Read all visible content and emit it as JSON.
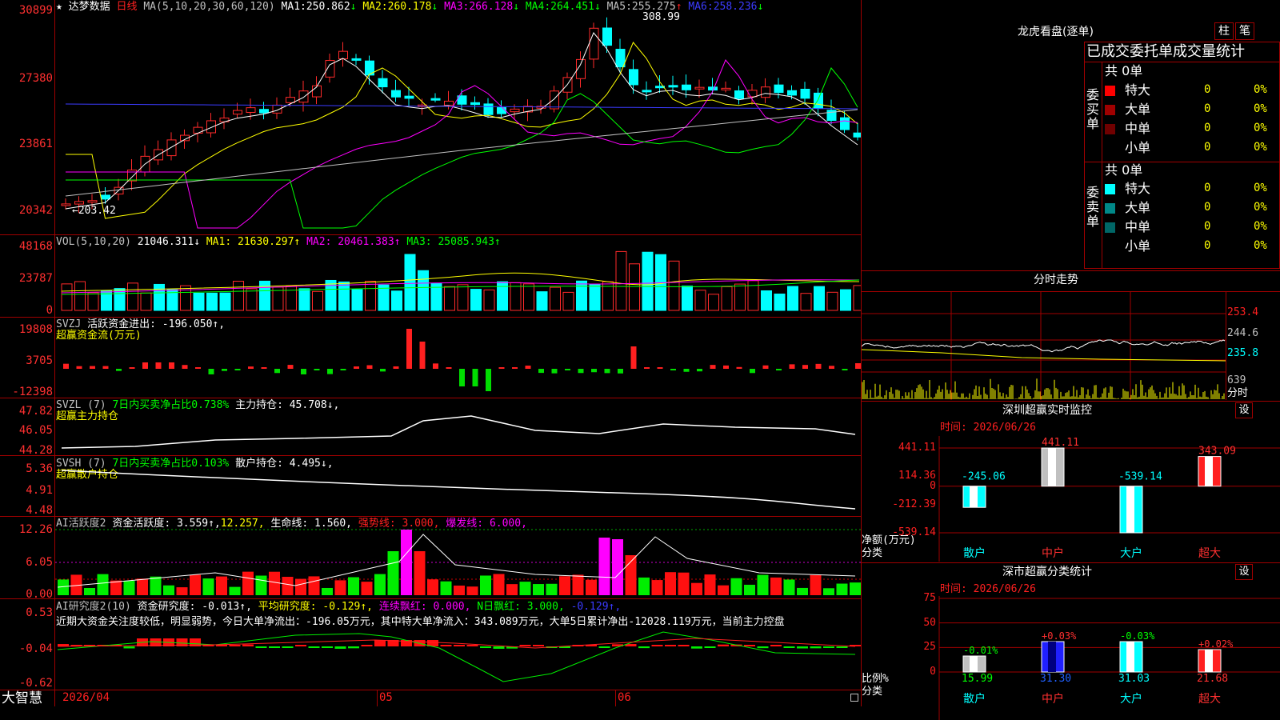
{
  "main": {
    "star": "★",
    "title": "达梦数据",
    "period": "日线",
    "ma_label": "MA(5,10,20,30,60,120)",
    "ma": [
      {
        "label": "MA1:",
        "value": "250.862",
        "arrow": "↓",
        "color": "#ffffff"
      },
      {
        "label": "MA2:",
        "value": "260.178",
        "arrow": "↓",
        "color": "#ffff00"
      },
      {
        "label": "MA3:",
        "value": "266.128",
        "arrow": "↓",
        "color": "#ff00ff"
      },
      {
        "label": "MA4:",
        "value": "264.451",
        "arrow": "↓",
        "color": "#00ff00"
      },
      {
        "label": "MA5:",
        "value": "255.275",
        "arrow": "↑",
        "color": "#c0c0c0"
      },
      {
        "label": "MA6:",
        "value": "258.236",
        "arrow": "↓",
        "color": "#3b3bff"
      }
    ],
    "axis": [
      "30899",
      "27380",
      "23861",
      "20342"
    ],
    "high_label": "308.99",
    "low_label": "←203.42",
    "arrow_low": "←"
  },
  "vol": {
    "label": "VOL(5,10,20)",
    "value": "21046.311↓",
    "ma1": "MA1: 21630.297↑",
    "ma2": "MA2: 20461.383↑",
    "ma3": "MA3: 25085.943↑",
    "axis": [
      "48168",
      "23787",
      "0"
    ]
  },
  "svzj": {
    "label": "SVZJ",
    "text": "活跃资金进出: -196.050↑,",
    "sub": "超赢资金流(万元)",
    "axis": [
      "19808",
      "3705",
      "-12398"
    ]
  },
  "svzl": {
    "label": "SVZL (7)",
    "text1": "7日内买卖净占比0.738%",
    "text2": "主力持仓: 45.708↓,",
    "sub": "超赢主力持仓",
    "axis": [
      "47.82",
      "46.05",
      "44.28"
    ]
  },
  "svsh": {
    "label": "SVSH (7)",
    "text1": "7日内买卖净占比0.103%",
    "text2": "散户持仓: 4.495↓,",
    "sub": "超赢散户持仓",
    "axis": [
      "5.36",
      "4.91",
      "4.48"
    ]
  },
  "ai1": {
    "label": "AI活跃度2",
    "t1": "资金活跃度: 3.559↑,",
    "t2": "12.257,",
    "t3": "生命线: 1.560,",
    "t4": "强势线: 3.000,",
    "t5": "爆发线: 6.000,",
    "axis": [
      "12.26",
      "6.05",
      "0.00"
    ]
  },
  "ai2": {
    "label": "AI研究度2(10)",
    "t1": "资金研究度: -0.013↑,",
    "t2": "平均研究度: -0.129↑,",
    "t3": "连续飘红: 0.000,",
    "t4": "N日飘红: 3.000,",
    "t5": "-0.129↑,",
    "comment": "近期大资金关注度较低，明显弱势，今日大单净流出：-196.05万元，其中特大单净流入：343.089万元，大单5日累计净出-12028.119万元，当前主力控盘",
    "axis": [
      "0.53",
      "-0.04",
      "-0.62"
    ]
  },
  "footer": {
    "brand": "大智慧",
    "date": "2026/04",
    "m05": "05",
    "m06": "06"
  },
  "lhb": {
    "title": "龙虎看盘(逐单)",
    "btn1": "柱",
    "btn2": "笔",
    "header": "已成交委托单成交量统计",
    "buy_side": "委买单",
    "sell_side": "委卖单",
    "buy_total": "共 0单",
    "sell_total": "共 0单",
    "buy_rows": [
      {
        "name": "特大",
        "val": "0",
        "pct": "0%",
        "color": "#ff0000"
      },
      {
        "name": "大单",
        "val": "0",
        "pct": "0%",
        "color": "#a00000"
      },
      {
        "name": "中单",
        "val": "0",
        "pct": "0%",
        "color": "#700000"
      },
      {
        "name": "小单",
        "val": "0",
        "pct": "0%",
        "color": ""
      }
    ],
    "sell_rows": [
      {
        "name": "特大",
        "val": "0",
        "pct": "0%",
        "color": "#00ffff"
      },
      {
        "name": "大单",
        "val": "0",
        "pct": "0%",
        "color": "#008888"
      },
      {
        "name": "中单",
        "val": "0",
        "pct": "0%",
        "color": "#006666"
      },
      {
        "name": "小单",
        "val": "0",
        "pct": "0%",
        "color": ""
      }
    ]
  },
  "fenshi": {
    "title": "分时走势",
    "axis": [
      "253.4",
      "244.6",
      "235.8",
      "639"
    ],
    "label": "分时"
  },
  "sz_monitor": {
    "title": "深圳超赢实时监控",
    "settings": "设",
    "time": "时间: 2026/06/26",
    "axis": [
      "441.11",
      "114.36",
      "0",
      "-212.39",
      "-539.14"
    ],
    "ylabel1": "净额(万元)",
    "ylabel2": "分类",
    "chart_data": {
      "type": "bar",
      "categories": [
        "散户",
        "中户",
        "大户",
        "超大"
      ],
      "values": [
        -245.06,
        441.11,
        -539.14,
        343.09
      ],
      "value_labels": [
        "-245.06",
        "441.11",
        "-539.14",
        "343.09"
      ],
      "ylim": [
        -539.14,
        441.11
      ]
    }
  },
  "sz_stats": {
    "title": "深市超赢分类统计",
    "settings": "设",
    "time": "时间: 2026/06/26",
    "axis": [
      "75",
      "50",
      "25",
      "0"
    ],
    "ylabel1": "比例%",
    "ylabel2": "分类",
    "chart_data": {
      "type": "bar",
      "categories": [
        "散户",
        "中户",
        "大户",
        "超大"
      ],
      "values": [
        15.99,
        31.3,
        31.03,
        21.68
      ],
      "value_labels": [
        "15.99",
        "31.30",
        "31.03",
        "21.68"
      ],
      "change_labels": [
        "-0.01%",
        "+0.03%",
        "-0.03%",
        "+0.02%"
      ],
      "ylim": [
        0,
        75
      ]
    }
  },
  "colors": {
    "up": "#ff2a2a",
    "down": "#00ffff",
    "grid": "#a00000",
    "axis_text": "#ff3030"
  }
}
